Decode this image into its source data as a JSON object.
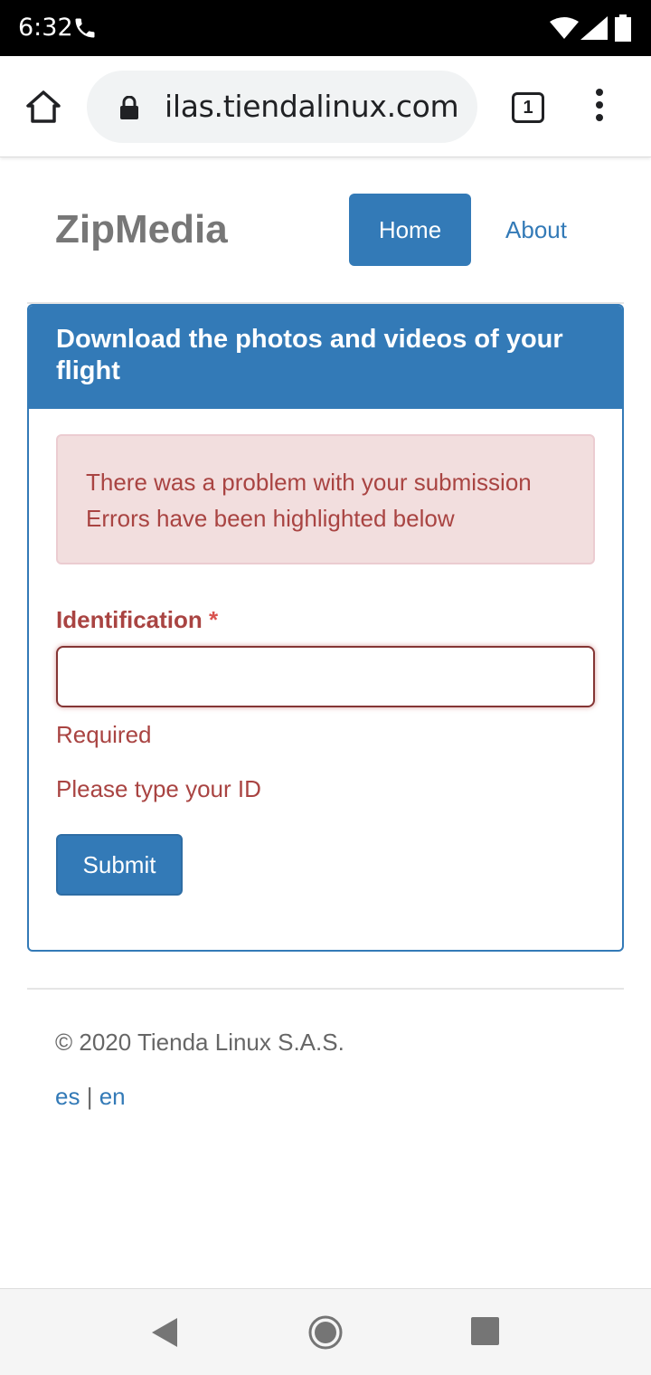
{
  "status_bar": {
    "time": "6:32",
    "icons": [
      "phone-icon",
      "wifi-icon",
      "signal-icon",
      "battery-icon"
    ]
  },
  "browser": {
    "url": "ilas.tiendalinux.com",
    "tab_count": "1",
    "icons": [
      "home-icon",
      "lock-icon",
      "tabs-icon",
      "menu-icon"
    ]
  },
  "header": {
    "brand": "ZipMedia",
    "nav": {
      "home": "Home",
      "about": "About"
    }
  },
  "panel": {
    "title": "Download the photos and videos of your flight",
    "alert": {
      "line1": "There was a problem with your submission",
      "line2": "Errors have been highlighted below"
    },
    "field": {
      "label": "Identification",
      "required_marker": "*",
      "value": "",
      "error_required": "Required",
      "help": "Please type your ID"
    },
    "submit_label": "Submit"
  },
  "footer": {
    "copyright": "© 2020 Tienda Linux S.A.S.",
    "languages": [
      "es",
      "en"
    ],
    "separator": "|"
  },
  "nav_bar": {
    "icons": [
      "back-icon",
      "home-circle-icon",
      "recent-apps-icon"
    ]
  },
  "colors": {
    "primary": "#337ab7",
    "danger_text": "#a94442",
    "danger_bg": "#f2dede",
    "danger_border": "#ebccd1"
  }
}
